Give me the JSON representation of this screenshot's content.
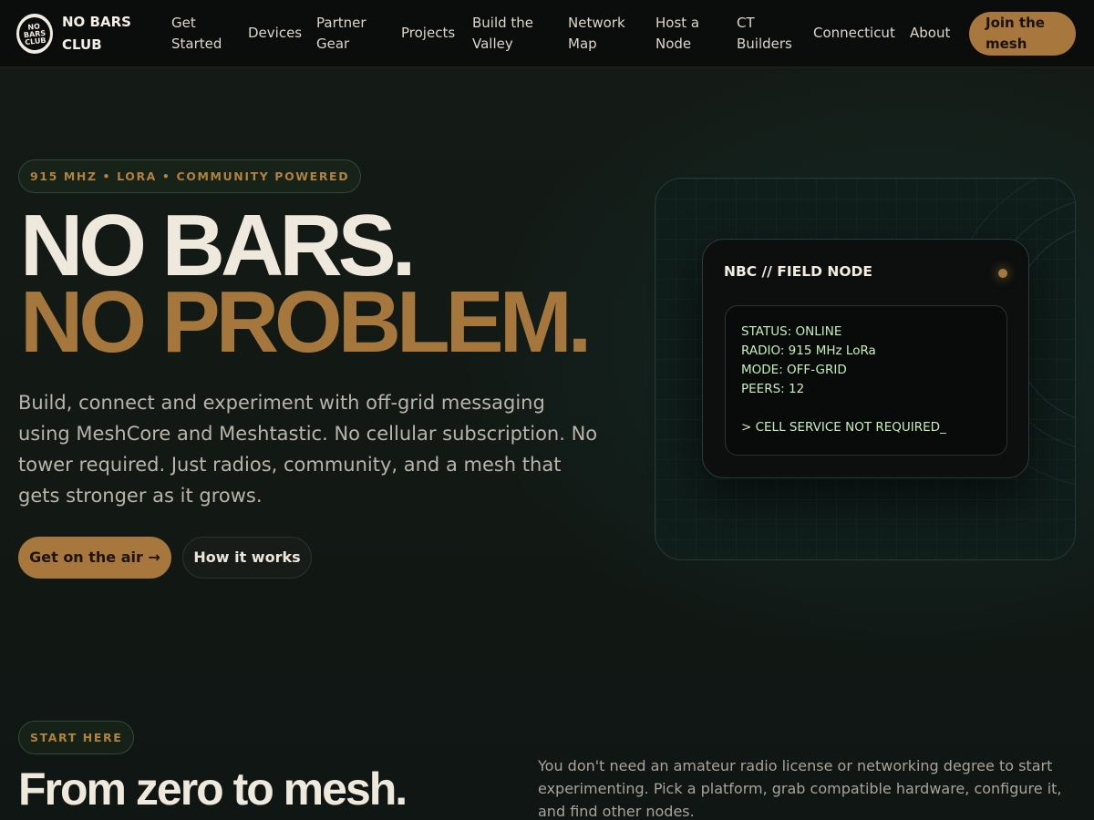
{
  "brand": {
    "logo_lines": [
      "NO",
      "BARS",
      "CLUB"
    ],
    "name": "NO BARS CLUB"
  },
  "nav": {
    "items": [
      {
        "label": "Get Started"
      },
      {
        "label": "Devices"
      },
      {
        "label": "Partner Gear"
      },
      {
        "label": "Projects"
      },
      {
        "label": "Build the Valley"
      },
      {
        "label": "Network Map"
      },
      {
        "label": "Host a Node"
      },
      {
        "label": "CT Builders"
      },
      {
        "label": "Connecticut"
      },
      {
        "label": "About"
      }
    ],
    "cta": "Join the mesh"
  },
  "hero": {
    "eyebrow": "915 MHZ • LORA • COMMUNITY POWERED",
    "headline_line1": "NO BARS.",
    "headline_line2": "NO PROBLEM.",
    "lead": "Build, connect and experiment with off-grid messaging using MeshCore and Meshtastic. No cellular subscription. No tower required. Just radios, community, and a mesh that gets stronger as it grows.",
    "primary_button": "Get on the air →",
    "secondary_button": "How it works"
  },
  "node_card": {
    "title": "NBC // FIELD NODE",
    "status_lines": [
      "STATUS: ONLINE",
      "RADIO: 915 MHz LoRa",
      "MODE: OFF-GRID",
      "PEERS: 12"
    ],
    "prompt_line": "> CELL SERVICE NOT REQUIRED_"
  },
  "start_section": {
    "eyebrow": "START HERE",
    "heading": "From zero to mesh.",
    "text": "You don't need an amateur radio license or networking degree to start experimenting. Pick a platform, grab compatible hardware, configure it, and find other nodes."
  },
  "colors": {
    "accent": "#a8773e",
    "background": "#121915",
    "text": "#efe8dc",
    "terminal_text": "#c8edbe"
  }
}
